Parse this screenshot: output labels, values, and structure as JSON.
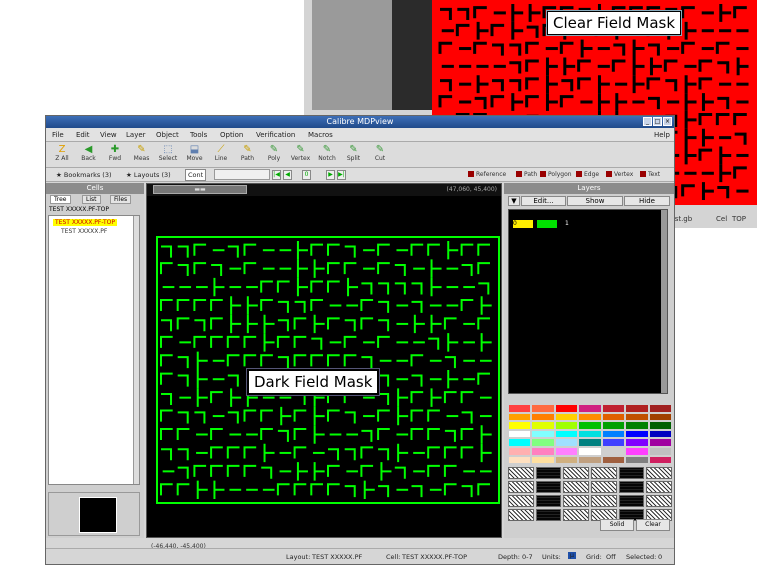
{
  "background_window": {
    "callout": "Clear Field Mask",
    "status_file": "y_test.gb",
    "status_cell_label": "Cel",
    "status_cell": "TOP"
  },
  "window": {
    "title": "Calibre MDPview",
    "controls": [
      "_",
      "□",
      "×"
    ]
  },
  "menu": {
    "items": [
      "File",
      "Edit",
      "View",
      "Layer",
      "Object",
      "Tools",
      "Option",
      "Verification",
      "Macros"
    ],
    "help": "Help"
  },
  "toolbar": {
    "tools": [
      {
        "label": "Z All",
        "icon": "Z",
        "color": "#e0a000",
        "icon_name": "zoom-all-icon"
      },
      {
        "label": "Back",
        "icon": "◀",
        "color": "#2a9a2a",
        "icon_name": "back-icon"
      },
      {
        "label": "Fwd",
        "icon": "✚",
        "color": "#2a9a2a",
        "icon_name": "forward-icon"
      },
      {
        "label": "Meas",
        "icon": "✎",
        "color": "#c8a000",
        "icon_name": "measure-icon"
      },
      {
        "label": "Select",
        "icon": "⬚",
        "color": "#5f7fb0",
        "icon_name": "select-icon"
      },
      {
        "label": "Move",
        "icon": "⬓",
        "color": "#5f7fb0",
        "icon_name": "move-icon"
      },
      {
        "label": "Line",
        "icon": "⟋",
        "color": "#c8a000",
        "icon_name": "line-icon"
      },
      {
        "label": "Path",
        "icon": "✎",
        "color": "#c8a000",
        "icon_name": "path-icon"
      },
      {
        "label": "Poly",
        "icon": "✎",
        "color": "#3a9a3a",
        "icon_name": "poly-icon"
      },
      {
        "label": "Vertex",
        "icon": "✎",
        "color": "#3a9a3a",
        "icon_name": "vertex-icon"
      },
      {
        "label": "Notch",
        "icon": "✎",
        "color": "#3a9a3a",
        "icon_name": "notch-icon"
      },
      {
        "label": "Split",
        "icon": "✎",
        "color": "#3a9a3a",
        "icon_name": "split-icon"
      },
      {
        "label": "Cut",
        "icon": "✎",
        "color": "#3a9a3a",
        "icon_name": "cut-icon"
      }
    ]
  },
  "row3": {
    "bookmarks": "Bookmarks (3)",
    "layouts": "Layouts (3)",
    "zoom_value": "Cont",
    "filters": [
      "Reference",
      "Path",
      "Polygon",
      "Edge",
      "Vertex",
      "Text"
    ]
  },
  "cells_panel": {
    "title": "Cells",
    "tabs": [
      "Tree",
      "List",
      "Files"
    ],
    "path": "TEST XXXXX.PF-TOP",
    "tree_items": [
      "TEST XXXXX.PF-TOP",
      "TEST XXXXX.PF"
    ]
  },
  "canvas": {
    "coord_top": "(47,060, 45,400)",
    "coord_bottom": "(-46,440, -45,400)",
    "callout": "Dark Field Mask"
  },
  "layers_panel": {
    "title": "Layers",
    "buttons": [
      "Edit...",
      "Show",
      "Hide"
    ],
    "layer_number": "0",
    "layer_name": "1",
    "palette": [
      "#ff4040",
      "#ff6a40",
      "#ff0000",
      "#d02080",
      "#c02030",
      "#b02020",
      "#a02020",
      "#ffa000",
      "#ff8000",
      "#ffd000",
      "#ff8c00",
      "#e06000",
      "#c05000",
      "#a04000",
      "#ffff00",
      "#e0ff00",
      "#a0ff00",
      "#00c000",
      "#00a000",
      "#008000",
      "#006000",
      "#ffffff",
      "#80ffff",
      "#00ffff",
      "#00e0e0",
      "#0080ff",
      "#0000ff",
      "#0000c0",
      "#00ffff",
      "#80ff80",
      "#a0e0ff",
      "#008080",
      "#4040ff",
      "#8000ff",
      "#a000a0",
      "#ffb0b0",
      "#ff80c0",
      "#ff80ff",
      "#ffffff",
      "#d0d0d0",
      "#ff40ff",
      "#c0c0c0",
      "#ffe0c0",
      "#ffe0a0",
      "#d0b080",
      "#c0a080",
      "#a06040",
      "#808080",
      "#d02060"
    ],
    "start_button": "Solid",
    "clear_button": "Clear"
  },
  "status": {
    "layout_label": "Layout:",
    "layout": "TEST XXXXX.PF",
    "cell_label": "Cell:",
    "cell": "TEST XXXXX.PF-TOP",
    "depth_label": "Depth:",
    "depth": "0-7",
    "units_label": "Units:",
    "grid_label": "Grid:",
    "grid": "Off",
    "selected_label": "Selected:",
    "selected": "0"
  }
}
